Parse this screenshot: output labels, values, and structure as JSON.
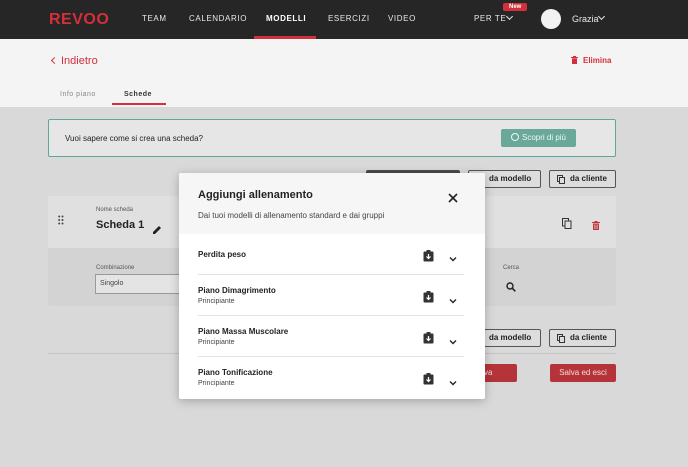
{
  "nav": {
    "logo": "REVOO",
    "items": [
      "TEAM",
      "CALENDARIO",
      "MODELLI",
      "ESERCIZI",
      "VIDEO"
    ],
    "per_te": "PER TE",
    "badge": "New",
    "user_name": "Grazia"
  },
  "page": {
    "back": "Indietro",
    "delete": "Elimina",
    "tabs": [
      "Info piano",
      "Schede"
    ],
    "info_text": "Vuoi sapere come si crea una scheda?",
    "discover": "Scopri di più",
    "from_model": "da modello",
    "from_client": "da cliente",
    "scheda_label": "Nome scheda",
    "scheda_name": "Scheda 1",
    "combo_label": "Combinazione",
    "combo_value": "Singolo",
    "search_label": "Cerca",
    "save_partial": "va",
    "save_exit": "Salva ed esci"
  },
  "modal": {
    "title": "Aggiungi allenamento",
    "subtitle": "Dai tuoi modelli di allenamento standard e dai gruppi",
    "rows": [
      {
        "title": "Perdita peso",
        "sub": ""
      },
      {
        "title": "Piano Dimagrimento",
        "sub": "Principiante"
      },
      {
        "title": "Piano Massa Muscolare",
        "sub": "Principiante"
      },
      {
        "title": "Piano Tonificazione",
        "sub": "Principiante"
      }
    ]
  },
  "colors": {
    "accent": "#d4303b",
    "nav_bg": "#262626",
    "teal": "#6aa89a"
  }
}
